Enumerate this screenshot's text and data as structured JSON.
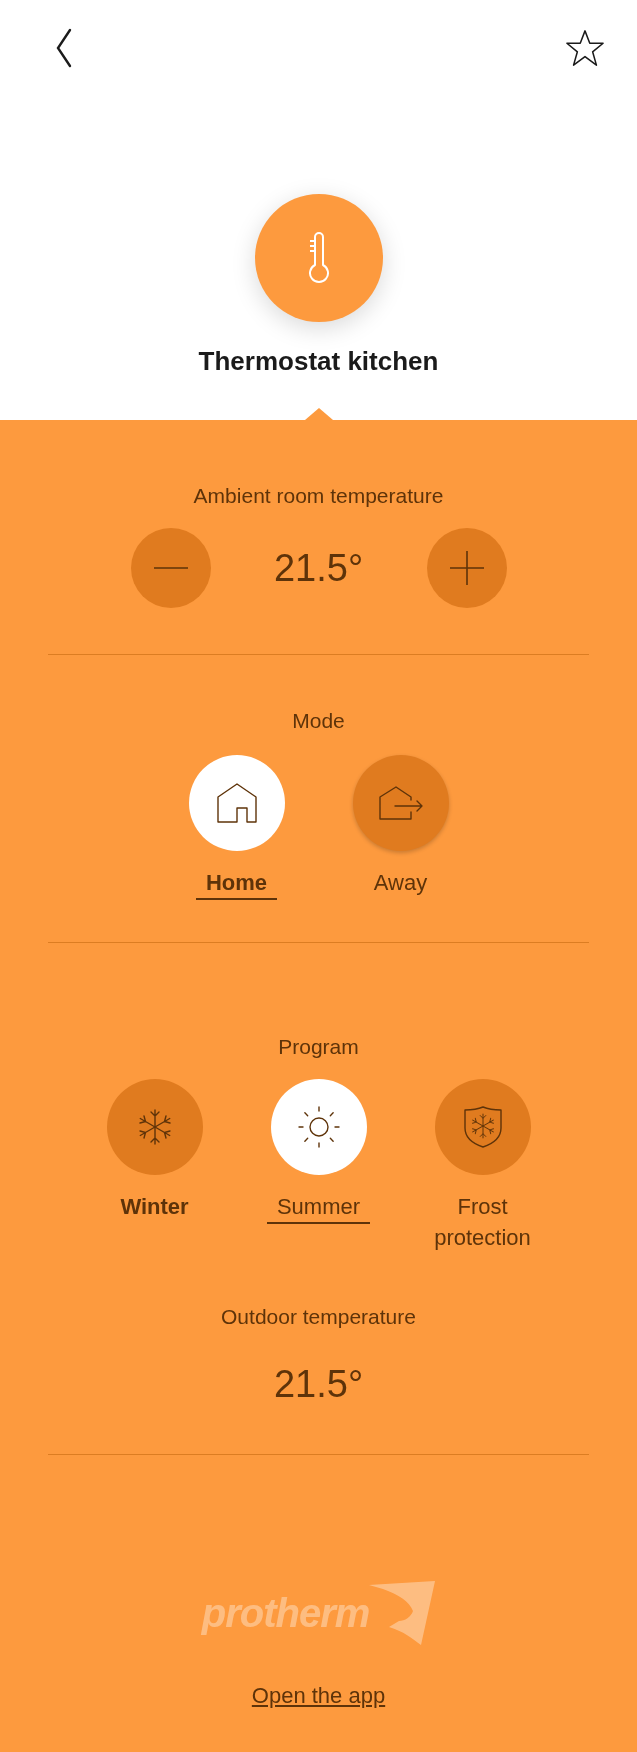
{
  "header": {
    "title": "Thermostat kitchen",
    "favorite": false
  },
  "ambient": {
    "label": "Ambient room temperature",
    "value": "21.5°"
  },
  "mode": {
    "label": "Mode",
    "options": [
      {
        "kind": "home",
        "label": "Home",
        "selected": true,
        "active": true
      },
      {
        "kind": "away",
        "label": "Away",
        "selected": false,
        "active": false
      }
    ]
  },
  "program": {
    "label": "Program",
    "options": [
      {
        "kind": "winter",
        "label": "Winter",
        "selected": false,
        "active": true
      },
      {
        "kind": "summer",
        "label": "Summer",
        "selected": true,
        "active": false
      },
      {
        "kind": "frost",
        "label": "Frost protection",
        "selected": false,
        "active": false
      }
    ]
  },
  "outdoor": {
    "label": "Outdoor temperature",
    "value": "21.5°"
  },
  "footer": {
    "brand": "protherm",
    "link": "Open the app"
  }
}
